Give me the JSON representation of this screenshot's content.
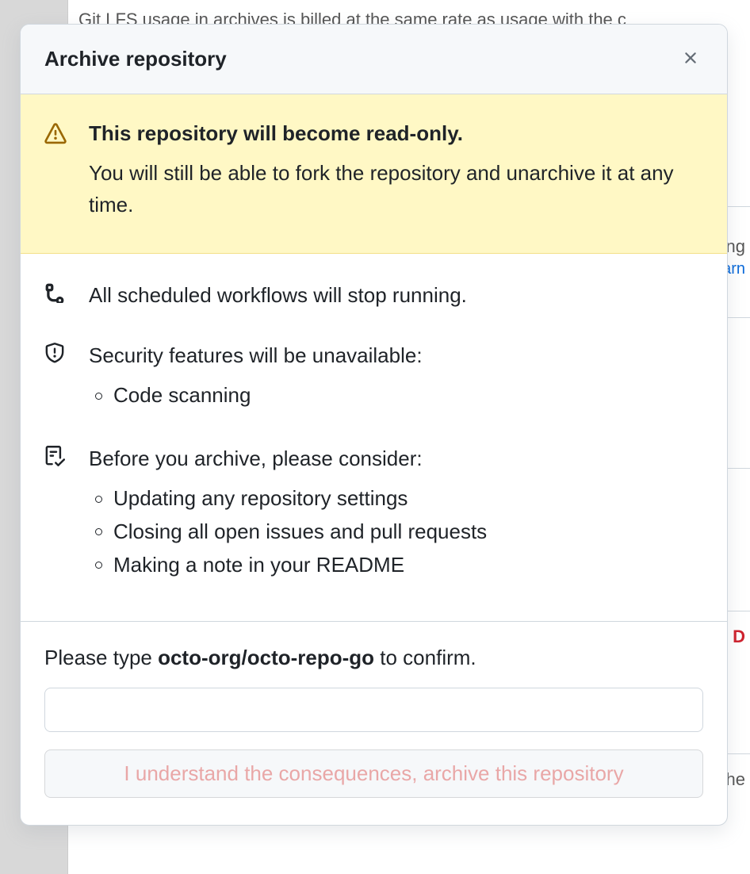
{
  "background": {
    "lfs_text": "Git LFS usage in archives is billed at the same rate as usage with the c",
    "link_fragment_1": "ng",
    "link_fragment_2": "arn",
    "danger_fragment": "D",
    "text_fragment": "he"
  },
  "modal": {
    "title": "Archive repository",
    "warn": {
      "title": "This repository will become read-only.",
      "sub": "You will still be able to fork the repository and unarchive it at any time."
    },
    "workflows": {
      "text": "All scheduled workflows will stop running."
    },
    "security": {
      "heading": "Security features will be unavailable:",
      "items": [
        "Code scanning"
      ]
    },
    "consider": {
      "heading": "Before you archive, please consider:",
      "items": [
        "Updating any repository settings",
        "Closing all open issues and pull requests",
        "Making a note in your README"
      ]
    },
    "confirm": {
      "prefix": "Please type ",
      "repo": "octo-org/octo-repo-go",
      "suffix": " to confirm."
    },
    "button": "I understand the consequences, archive this repository"
  }
}
